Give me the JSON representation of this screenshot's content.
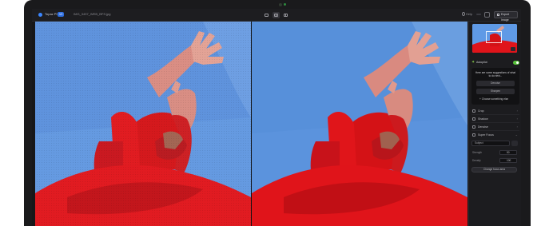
{
  "app": {
    "name": "Topaz Photo",
    "version_badge": "V2",
    "file_name": "IMG_3497_WEB_BFS.jpg"
  },
  "toolbar": {
    "help_label": "Help",
    "export_label": "Export Image",
    "view_modes": [
      "single-view",
      "side-by-side",
      "split-view"
    ],
    "active_view": "side-by-side"
  },
  "panel": {
    "autopilot_label": "Autopilot",
    "autopilot_enabled": true,
    "ai_message": "Here are some suggestions of what to do next...",
    "suggestions": [
      "Denoise",
      "Sharpen"
    ],
    "choose_label": "Choose something else",
    "sections": [
      "Crop",
      "Shadow",
      "Denoise",
      "Super Focus"
    ],
    "subject_select": "Subject",
    "params": [
      {
        "label": "Strength",
        "value": "50"
      },
      {
        "label": "Density",
        "value": "100"
      }
    ],
    "change_focus_label": "Change focus area"
  },
  "colors": {
    "accent_blue": "#3a86ff",
    "toggle_green": "#57c23a",
    "sky_blue": "#5a94e0",
    "garment_red": "#e0141a"
  },
  "icons": [
    "logo-icon",
    "help-icon",
    "settings-icon",
    "export-icon",
    "star-icon",
    "crop-icon",
    "shadow-icon",
    "denoise-icon",
    "focus-icon"
  ]
}
